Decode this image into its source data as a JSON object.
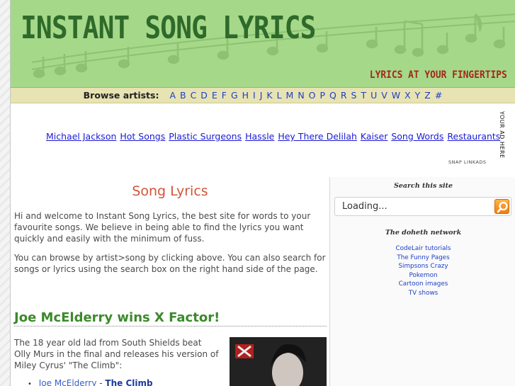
{
  "header": {
    "logo": "INSTANT SONG LYRICS",
    "tagline": "LYRICS AT YOUR FINGERTIPS"
  },
  "browse": {
    "label": "Browse artists:",
    "letters": [
      "A",
      "B",
      "C",
      "D",
      "E",
      "F",
      "G",
      "H",
      "I",
      "J",
      "K",
      "L",
      "M",
      "N",
      "O",
      "P",
      "Q",
      "R",
      "S",
      "T",
      "U",
      "V",
      "W",
      "X",
      "Y",
      "Z",
      "#"
    ]
  },
  "ads": {
    "links": [
      "Michael Jackson",
      "Hot Songs",
      "Plastic Surgeons",
      "Hassle",
      "Hey There Delilah",
      "Kaiser",
      "Song Words",
      "Restaurants"
    ],
    "vertical_label": "YOUR AD HERE",
    "snap_label": "SNAP LINKADS"
  },
  "main": {
    "title": "Song Lyrics",
    "intro_1": "Hi and welcome to Instant Song Lyrics, the best site for words to your favourite songs. We believe in being able to find the lyrics you want quickly and easily with the minimum of fuss.",
    "intro_2": "You can browse by artist>song by clicking above. You can also search for songs or lyrics using the search box on the right hand side of the page.",
    "news_title": "Joe McElderry wins X Factor!",
    "news_text": "The 18 year old lad from South Shields beat Olly Murs in the final and releases his version of Miley Cyrus' \"The Climb\":",
    "news_artist": "Joe McElderry",
    "news_separator": " - ",
    "news_song": "The Climb"
  },
  "sidebar": {
    "search_heading": "Search this site",
    "search_value": "Loading...",
    "network_heading": "The doheth network",
    "network_links": [
      "CodeLair tutorials",
      "The Funny Pages",
      "Simpsons Crazy",
      "Pokemon",
      "Cartoon images",
      "TV shows"
    ]
  },
  "colors": {
    "header_green": "#a6d88a",
    "logo_green": "#2e6a2a",
    "tagline_red": "#a2281c",
    "browse_bar": "#e7e3b3",
    "title_orange": "#d2543a",
    "news_green": "#3c8a2c",
    "link_blue": "#1d3fc4",
    "search_button_orange": "#f07c10"
  },
  "icons": {
    "search_button": "search-icon",
    "header_decoration": "music-note-icon"
  }
}
